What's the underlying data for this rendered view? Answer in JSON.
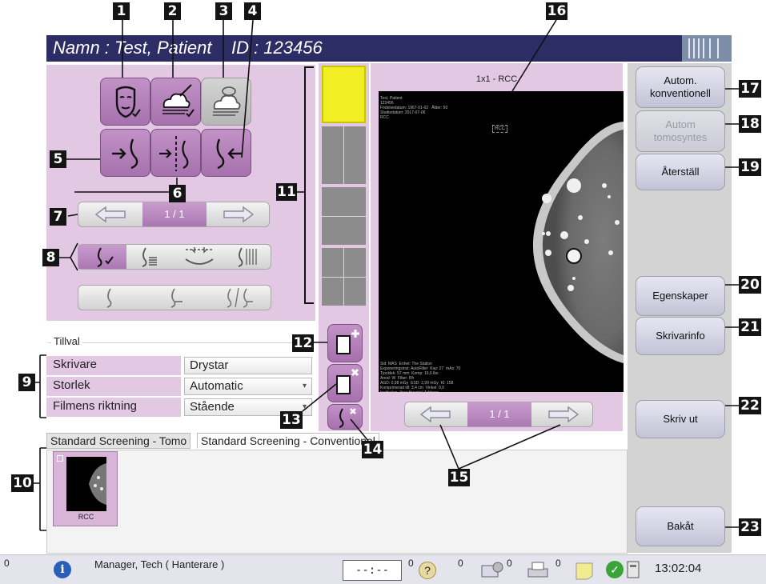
{
  "header": {
    "title": "Namn : Test, Patient    ID : 123456"
  },
  "callouts": [
    "1",
    "2",
    "3",
    "4",
    "5",
    "6",
    "7",
    "8",
    "9",
    "10",
    "11",
    "12",
    "13",
    "14",
    "15",
    "16",
    "17",
    "18",
    "19",
    "20",
    "21",
    "22",
    "23"
  ],
  "icons": {
    "row1": [
      "face-mask-icon",
      "cloud-edit-icon",
      "cloud-view-icon"
    ],
    "row2": [
      "breast-arrow-right-icon",
      "breast-flip-icon",
      "breast-arrow-left-icon"
    ]
  },
  "paging": {
    "left_label": "1 / 1",
    "viewer_label": "1 / 1"
  },
  "options": {
    "heading": "Tillval",
    "rows": [
      {
        "label": "Skrivare",
        "value": "Drystar"
      },
      {
        "label": "Storlek",
        "value": "Automatic"
      },
      {
        "label": "Filmens riktning",
        "value": "Stående"
      }
    ]
  },
  "viewer": {
    "layout_title": "1x1 - RCC",
    "overlay_top": "Test, Patient\n123456\nFödelsedatum: 1967-01-02   Ålder: 50\nStudiedatum: 2017-07-06\nRCC",
    "overlay_bottom": "Sid: MAS  Enhet: The Station\nExponeringsinst: AutoFilter  Kvp: 27  mAs: 70\nTjocklek: 57 mm  Komp: 16,6 lbs\nAnod: W  Filter: Rh\nAGD: 0,98 mGy  ESD: 2,99 mGy  KI: 158\nKomprimerad till: 3,4 cm  Vinkel: 0,0\nInstitution: Your Hospital Address\nAdress: Your Hospital Address",
    "marker": "RCC"
  },
  "right_buttons": [
    {
      "label": "Autom.\nkonventionell",
      "enabled": true
    },
    {
      "label": "Autom\ntomosyntes",
      "enabled": false
    },
    {
      "label": "Återställ",
      "enabled": true
    },
    {
      "label": "Egenskaper",
      "enabled": true
    },
    {
      "label": "Skrivarinfo",
      "enabled": true
    },
    {
      "label": "Skriv ut",
      "enabled": true
    },
    {
      "label": "Bakåt",
      "enabled": true
    }
  ],
  "tabs": [
    {
      "label": "Standard Screening - Tomo",
      "active": false
    },
    {
      "label": "Standard Screening - Conventional",
      "active": true
    }
  ],
  "thumbnail": {
    "label": "RCC"
  },
  "status": {
    "user": "Manager, Tech ( Hanterare )",
    "counter_left": "0",
    "timer": "--:--",
    "counts": [
      "0",
      "0",
      "0",
      "0"
    ],
    "clock": "13:02:04"
  },
  "colors": {
    "header": "#2d2d66",
    "panel": "#e3c8e3",
    "accent": "#a671ad",
    "highlight": "#f2ee24"
  }
}
